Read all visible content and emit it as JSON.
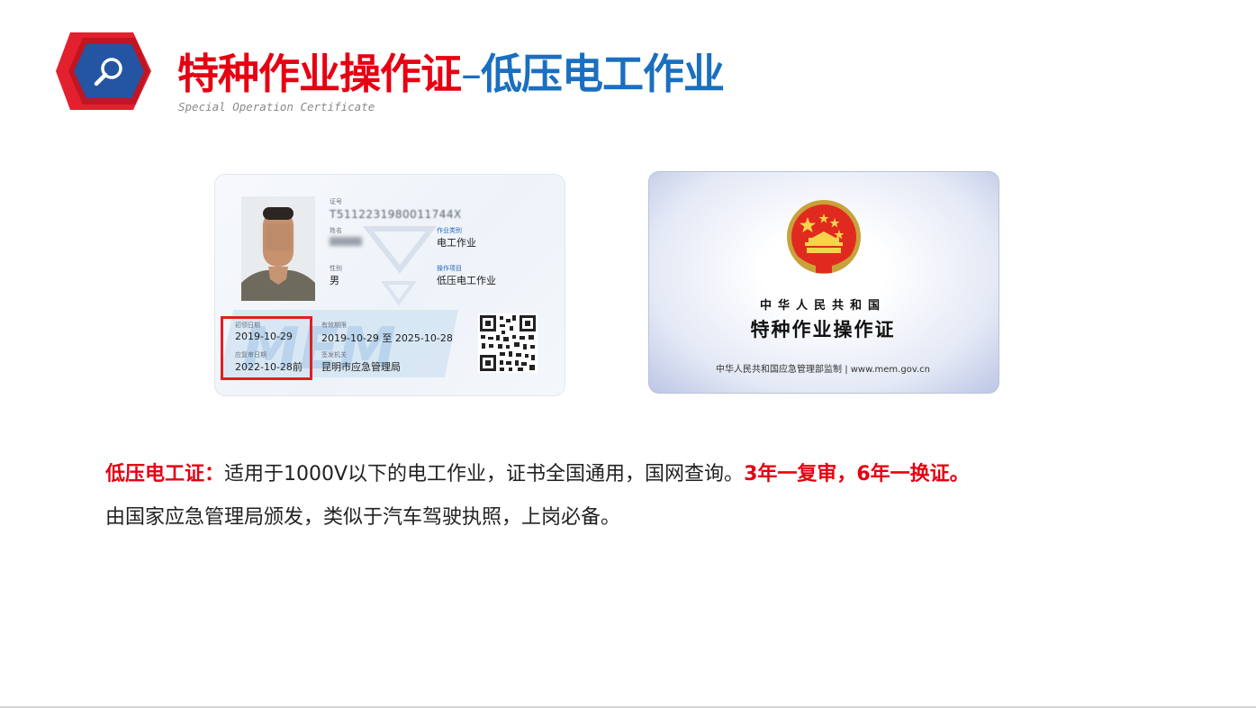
{
  "header": {
    "title_red": "特种作业操作证",
    "title_dash": "–",
    "title_blue": "低压电工作业",
    "subtitle": "Special Operation Certificate",
    "icon": "search-icon",
    "colors": {
      "red": "#e60012",
      "blue": "#1a6fc0",
      "logo_blue": "#2355a3"
    }
  },
  "card_front": {
    "id_label": "证号",
    "id_number": "T5112231980011744X",
    "name_label": "姓名",
    "gender_label": "性别",
    "gender": "男",
    "job_category_label": "作业类别",
    "job_category": "电工作业",
    "job_item_label": "操作项目",
    "job_item": "低压电工作业",
    "first_issue_label": "初领日期",
    "first_issue": "2019-10-29",
    "validity_label": "有效期限",
    "validity": "2019-10-29 至 2025-10-28",
    "review_label": "应复审日期",
    "review": "2022-10-28前",
    "issuer_label": "签发机关",
    "issuer": "昆明市应急管理局"
  },
  "card_back": {
    "country": "中华人民共和国",
    "title": "特种作业操作证",
    "footer": "中华人民共和国应急管理部监制 | www.mem.gov.cn",
    "emblem_icon": "national-emblem-icon"
  },
  "description": {
    "line1_label": "低压电工证：",
    "line1_text": "适用于1000V以下的电工作业，证书全国通用，国网查询。",
    "line1_highlight": "3年一复审，6年一换证。",
    "line2": "由国家应急管理局颁发，类似于汽车驾驶执照，上岗必备。"
  }
}
